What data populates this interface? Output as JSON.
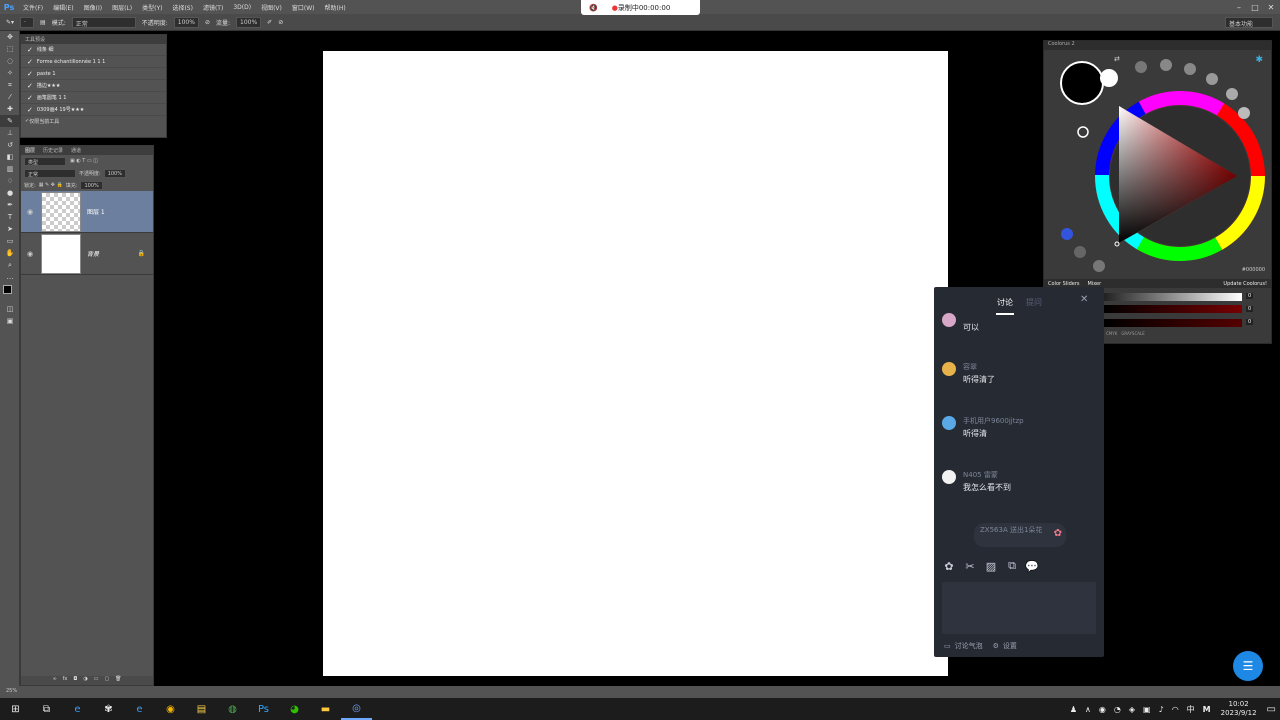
{
  "menubar": {
    "logo": "Ps",
    "items": [
      "文件(F)",
      "编辑(E)",
      "图像(I)",
      "图层(L)",
      "类型(Y)",
      "选择(S)",
      "滤镜(T)",
      "3D(D)",
      "视图(V)",
      "窗口(W)",
      "帮助(H)"
    ],
    "window_controls": [
      "–",
      "□",
      "✕"
    ]
  },
  "options": {
    "mode_label": "模式:",
    "mode_value": "正常",
    "opacity_label": "不透明度:",
    "opacity_value": "100%",
    "flow_label": "流量:",
    "flow_value": "100%",
    "workspace": "基本功能"
  },
  "recorder": {
    "text": "录制中00:00:00"
  },
  "brush_panel": {
    "title": "工具预设",
    "items": [
      "线条 细",
      "Forme échantillonnée 1 1 1",
      "paste 1",
      "描边★★★",
      "画笔圆笔 1 1",
      "0309画4 19号★★★"
    ],
    "footer": "仅限当前工具"
  },
  "layers_panel": {
    "tabs": [
      "图层",
      "历史记录",
      "通道"
    ],
    "kind": "类型",
    "blend": "正常",
    "opacity_label": "不透明度:",
    "opacity": "100%",
    "lock_label": "锁定:",
    "fill_label": "填充:",
    "fill": "100%",
    "layers": [
      {
        "name": "图层 1",
        "selected": true
      },
      {
        "name": "背景",
        "selected": false
      }
    ]
  },
  "color_panel": {
    "title": "Coolorus 2",
    "hex": "#000000",
    "tab1": "Color Sliders",
    "tab2": "Mixer",
    "update": "Update Coolorus!",
    "slider_values": [
      "0",
      "0",
      "0"
    ],
    "modes": [
      "CMYK",
      "GRAYSCALE"
    ]
  },
  "chat": {
    "tab_active": "讨论",
    "tab_other": "提问",
    "close": "✕",
    "messages": [
      {
        "user": "",
        "text": "可以"
      },
      {
        "user": "容翠",
        "text": "听得清了"
      },
      {
        "user": "手机用户9600jjtzp",
        "text": "听得清"
      },
      {
        "user": "N405 雷蒙",
        "text": "我怎么看不到"
      }
    ],
    "gift_notice": "ZX563A 送出1朵花",
    "footer_left": "讨论气泡",
    "footer_right": "设置"
  },
  "taskbar": {
    "time": "10:02",
    "date": "2023/9/12",
    "ime": "中",
    "ime2": "M"
  },
  "ps_status": {
    "zoom": "25%"
  },
  "colors": {
    "accent": "#4aa3ff",
    "chat_bg": "#262a33",
    "selected_layer": "#6d7f9e"
  }
}
